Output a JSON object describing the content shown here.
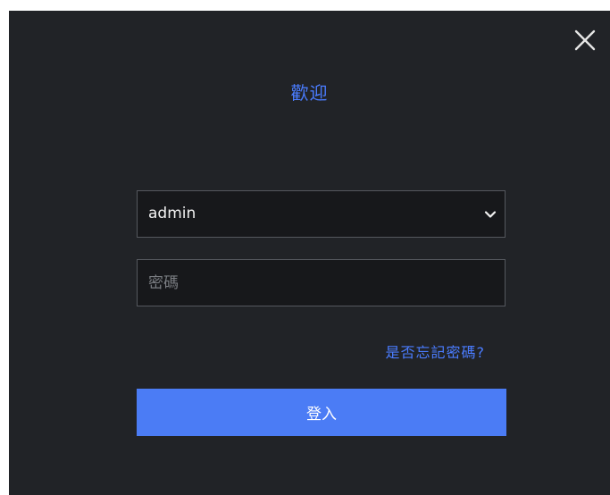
{
  "dialog": {
    "title": "歡迎",
    "close_icon": "close-icon"
  },
  "login_form": {
    "username_value": "admin",
    "username_dropdown_icon": "chevron-down-icon",
    "password_placeholder": "密碼",
    "forgot_password_link": "是否忘記密碼?",
    "login_button_label": "登入"
  },
  "colors": {
    "background": "#212327",
    "accent": "#4a7cff",
    "button": "#4b7cf5",
    "input_bg": "#17181b",
    "input_border": "#55585e"
  }
}
